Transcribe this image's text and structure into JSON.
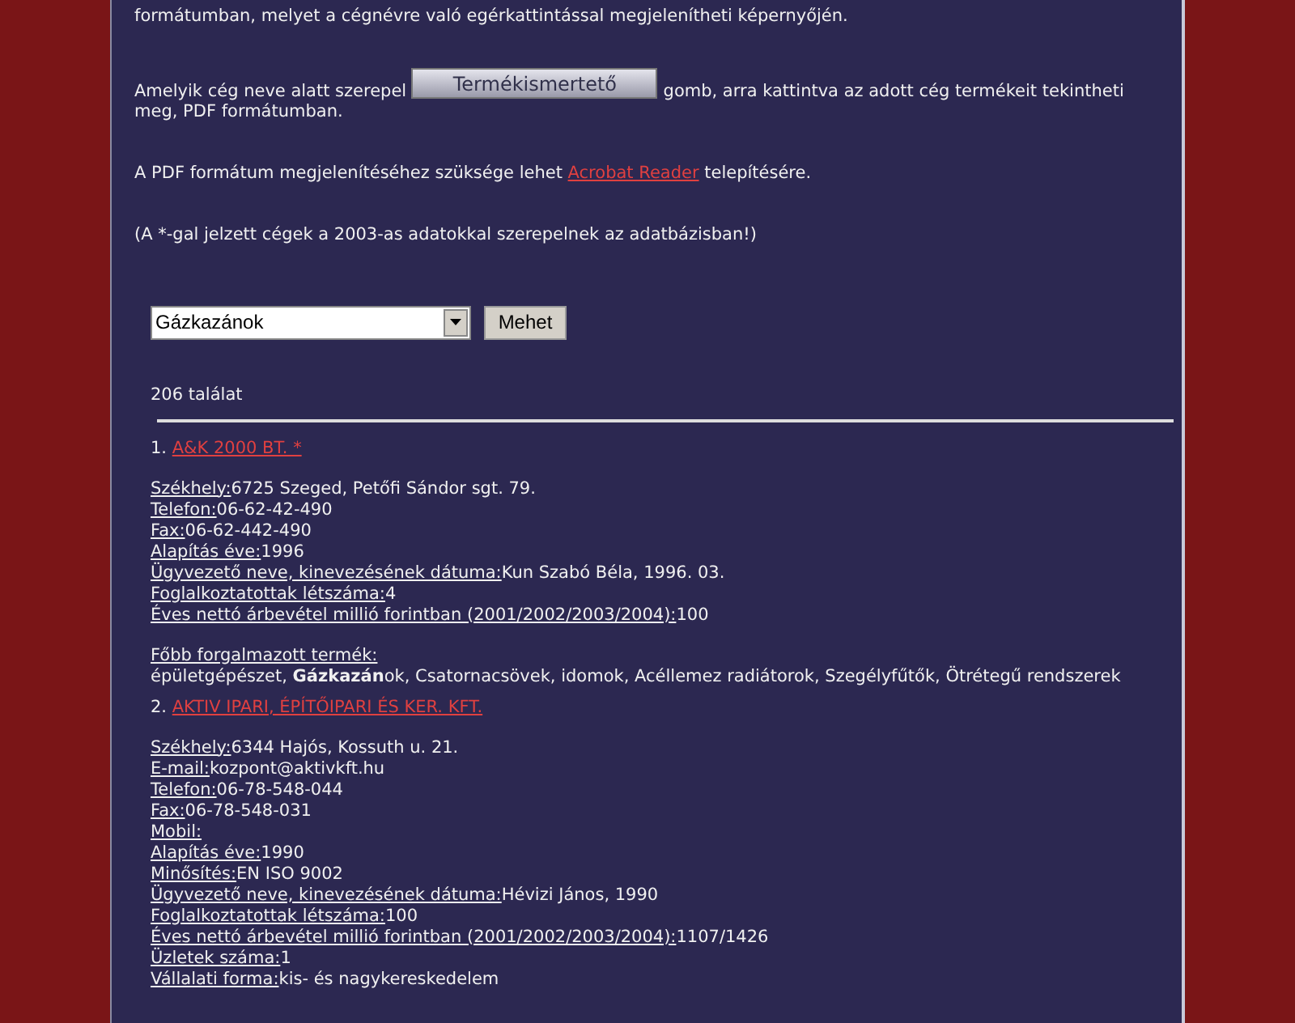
{
  "intro": [
    {
      "kind": "text",
      "text": "formátumban, melyet a cégnévre való egérkattintással megjelenítheti képernyőjén."
    },
    {
      "kind": "button",
      "before": "Amelyik cég neve alatt szerepel",
      "button": "Termékismertető",
      "after": "gomb, arra kattintva az adott cég termékeit tekintheti meg, PDF formátumban."
    },
    {
      "kind": "link",
      "before": "A PDF formátum megjelenítéséhez szüksége lehet",
      "link": "Acrobat Reader",
      "after": "telepítésére."
    },
    {
      "kind": "text",
      "text": "(A *-gal jelzett cégek a 2003-as adatokkal szerepelnek az adatbázisban!)"
    }
  ],
  "search": {
    "category": "Gázkazánok",
    "button": "Mehet"
  },
  "result_count": "206 találat",
  "companies": [
    {
      "number": "1.",
      "name": "A&K 2000 BT. *",
      "fields": [
        {
          "label": "Székhely:",
          "value": "6725 Szeged, Petőfi Sándor sgt. 79."
        },
        {
          "label": "Telefon:",
          "value": "06-62-42-490"
        },
        {
          "label": "Fax:",
          "value": "06-62-442-490"
        },
        {
          "label": "Alapítás éve:",
          "value": "1996"
        },
        {
          "label": "Ügyvezető neve, kinevezésének dátuma:",
          "value": "Kun Szabó Béla, 1996. 03."
        },
        {
          "label": "Foglalkoztatottak létszáma:",
          "value": "4"
        },
        {
          "label": "Éves nettó árbevétel millió forintban (2001/2002/2003/2004):",
          "value": "100"
        }
      ],
      "products_label": "Főbb forgalmazott termék:",
      "products": "épületgépészet, **Gázkazán**ok, Csatornacsövek, idomok, Acéllemez radiátorok, Szegélyfűtők, Ötrétegű rendszerek"
    },
    {
      "number": "2.",
      "name": "AKTIV IPARI, ÉPÍTŐIPARI ÉS KER. KFT.",
      "fields": [
        {
          "label": "Székhely:",
          "value": "6344 Hajós, Kossuth u. 21."
        },
        {
          "label": "E-mail:",
          "value": "kozpont@aktivkft.hu"
        },
        {
          "label": "Telefon:",
          "value": "06-78-548-044"
        },
        {
          "label": "Fax:",
          "value": "06-78-548-031"
        },
        {
          "label": "Mobil:"
        },
        {
          "label": "Alapítás éve:",
          "value": "1990"
        },
        {
          "label": "Minősítés:",
          "value": "EN ISO 9002"
        },
        {
          "label": "Ügyvezető neve, kinevezésének dátuma:",
          "value": "Hévizi János, 1990"
        },
        {
          "label": "Foglalkoztatottak létszáma:",
          "value": "100"
        },
        {
          "label": "Éves nettó árbevétel millió forintban (2001/2002/2003/2004):",
          "value": "1107/1426"
        },
        {
          "label": "Üzletek száma:",
          "value": "1"
        },
        {
          "label": "Vállalati forma:",
          "value": "kis- és nagykereskedelem"
        }
      ]
    }
  ]
}
